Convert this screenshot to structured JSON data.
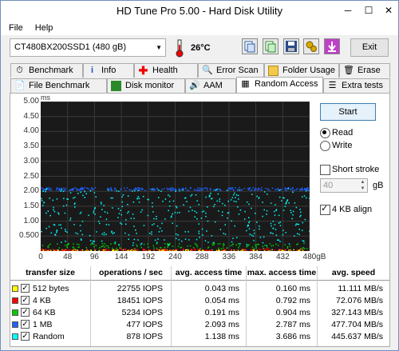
{
  "window": {
    "title": "HD Tune Pro 5.00 - Hard Disk Utility"
  },
  "menu": {
    "file": "File",
    "help": "Help"
  },
  "toolbar": {
    "drive": "CT480BX200SSD1 (480 gB)",
    "temperature": "26°C",
    "exit_label": "Exit"
  },
  "tabs_top": [
    "Benchmark",
    "Info",
    "Health",
    "Error Scan",
    "Folder Usage",
    "Erase"
  ],
  "tabs_bottom": [
    "File Benchmark",
    "Disk monitor",
    "AAM",
    "Random Access",
    "Extra tests"
  ],
  "active_tab": "Random Access",
  "side": {
    "start_label": "Start",
    "read_label": "Read",
    "write_label": "Write",
    "short_stroke_label": "Short stroke",
    "stroke_value": "40",
    "stroke_unit": "gB",
    "align_label": "4 KB align",
    "mode": "read",
    "short_stroke": false,
    "align_4kb": true
  },
  "chart_data": {
    "type": "scatter",
    "xlabel": "",
    "ylabel": "",
    "x_unit": "gB",
    "y_unit": "ms",
    "x_ticks": [
      "0",
      "48",
      "96",
      "144",
      "192",
      "240",
      "288",
      "336",
      "384",
      "432",
      "480gB"
    ],
    "y_ticks": [
      "5.00",
      "4.50",
      "4.00",
      "3.50",
      "3.00",
      "2.50",
      "2.00",
      "1.50",
      "1.00",
      "0.500"
    ],
    "xlim": [
      0,
      480
    ],
    "ylim": [
      0,
      5.0
    ],
    "grid": true,
    "series": [
      {
        "name": "512 bytes",
        "color": "#ffff00",
        "avg": 0.043
      },
      {
        "name": "4 KB",
        "color": "#ff0000",
        "avg": 0.054
      },
      {
        "name": "64 KB",
        "color": "#00cc00",
        "avg": 0.191
      },
      {
        "name": "1 MB",
        "color": "#2060ff",
        "avg": 2.093
      },
      {
        "name": "Random",
        "color": "#00ffff",
        "avg": 1.138
      }
    ]
  },
  "table": {
    "headers": [
      "transfer size",
      "operations / sec",
      "avg. access time",
      "max. access time",
      "avg. speed"
    ],
    "rows": [
      {
        "name": "512 bytes",
        "color": "#ffff00",
        "ops": "22755 IOPS",
        "avg": "0.043 ms",
        "max": "0.160 ms",
        "speed": "11.111 MB/s"
      },
      {
        "name": "4 KB",
        "color": "#ff0000",
        "ops": "18451 IOPS",
        "avg": "0.054 ms",
        "max": "0.792 ms",
        "speed": "72.076 MB/s"
      },
      {
        "name": "64 KB",
        "color": "#00cc00",
        "ops": "5234 IOPS",
        "avg": "0.191 ms",
        "max": "0.904 ms",
        "speed": "327.143 MB/s"
      },
      {
        "name": "1 MB",
        "color": "#2060ff",
        "ops": "477 IOPS",
        "avg": "2.093 ms",
        "max": "2.787 ms",
        "speed": "477.704 MB/s"
      },
      {
        "name": "Random",
        "color": "#00ffff",
        "ops": "878 IOPS",
        "avg": "1.138 ms",
        "max": "3.686 ms",
        "speed": "445.637 MB/s"
      }
    ]
  }
}
